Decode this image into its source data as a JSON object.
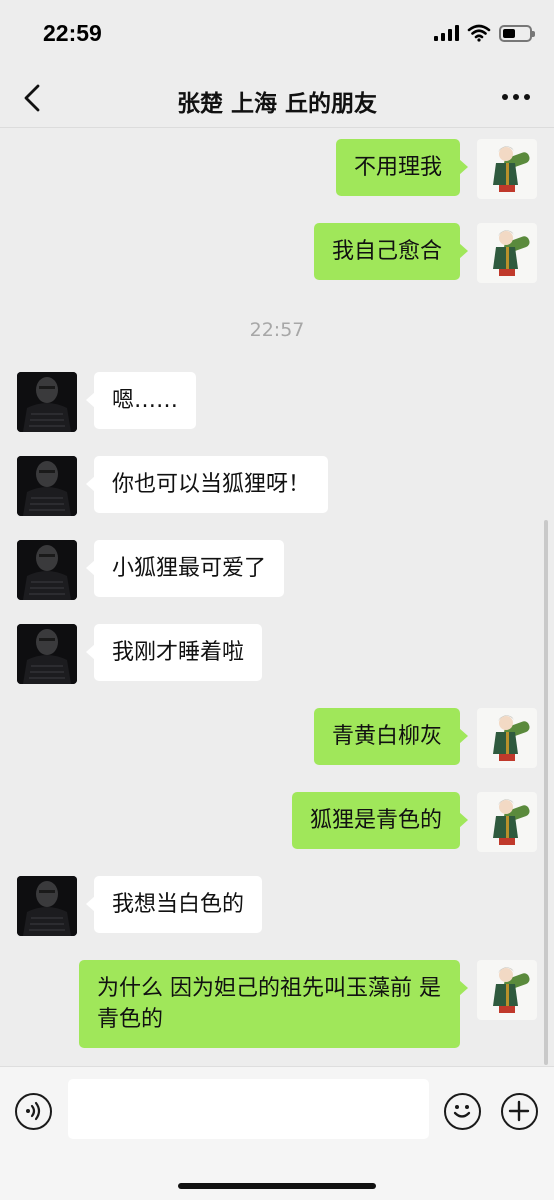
{
  "status_bar": {
    "time": "22:59",
    "battery_level": 0.48
  },
  "header": {
    "title": "张楚 上海 丘的朋友"
  },
  "chat": {
    "timestamp": "22:57",
    "messages": [
      {
        "sender": "self",
        "text": "不用理我"
      },
      {
        "sender": "self",
        "text": "我自己愈合"
      },
      {
        "sender": "other",
        "text": "嗯……"
      },
      {
        "sender": "other",
        "text": "你也可以当狐狸呀！"
      },
      {
        "sender": "other",
        "text": "小狐狸最可爱了"
      },
      {
        "sender": "other",
        "text": "我刚才睡着啦"
      },
      {
        "sender": "self",
        "text": "青黄白柳灰"
      },
      {
        "sender": "self",
        "text": "狐狸是青色的"
      },
      {
        "sender": "other",
        "text": "我想当白色的"
      },
      {
        "sender": "self",
        "text": "为什么 因为妲己的祖先叫玉藻前 是青色的"
      }
    ]
  },
  "input_bar": {
    "value": ""
  },
  "colors": {
    "self_bubble": "#a0e75a",
    "other_bubble": "#ffffff",
    "background": "#ededed"
  }
}
